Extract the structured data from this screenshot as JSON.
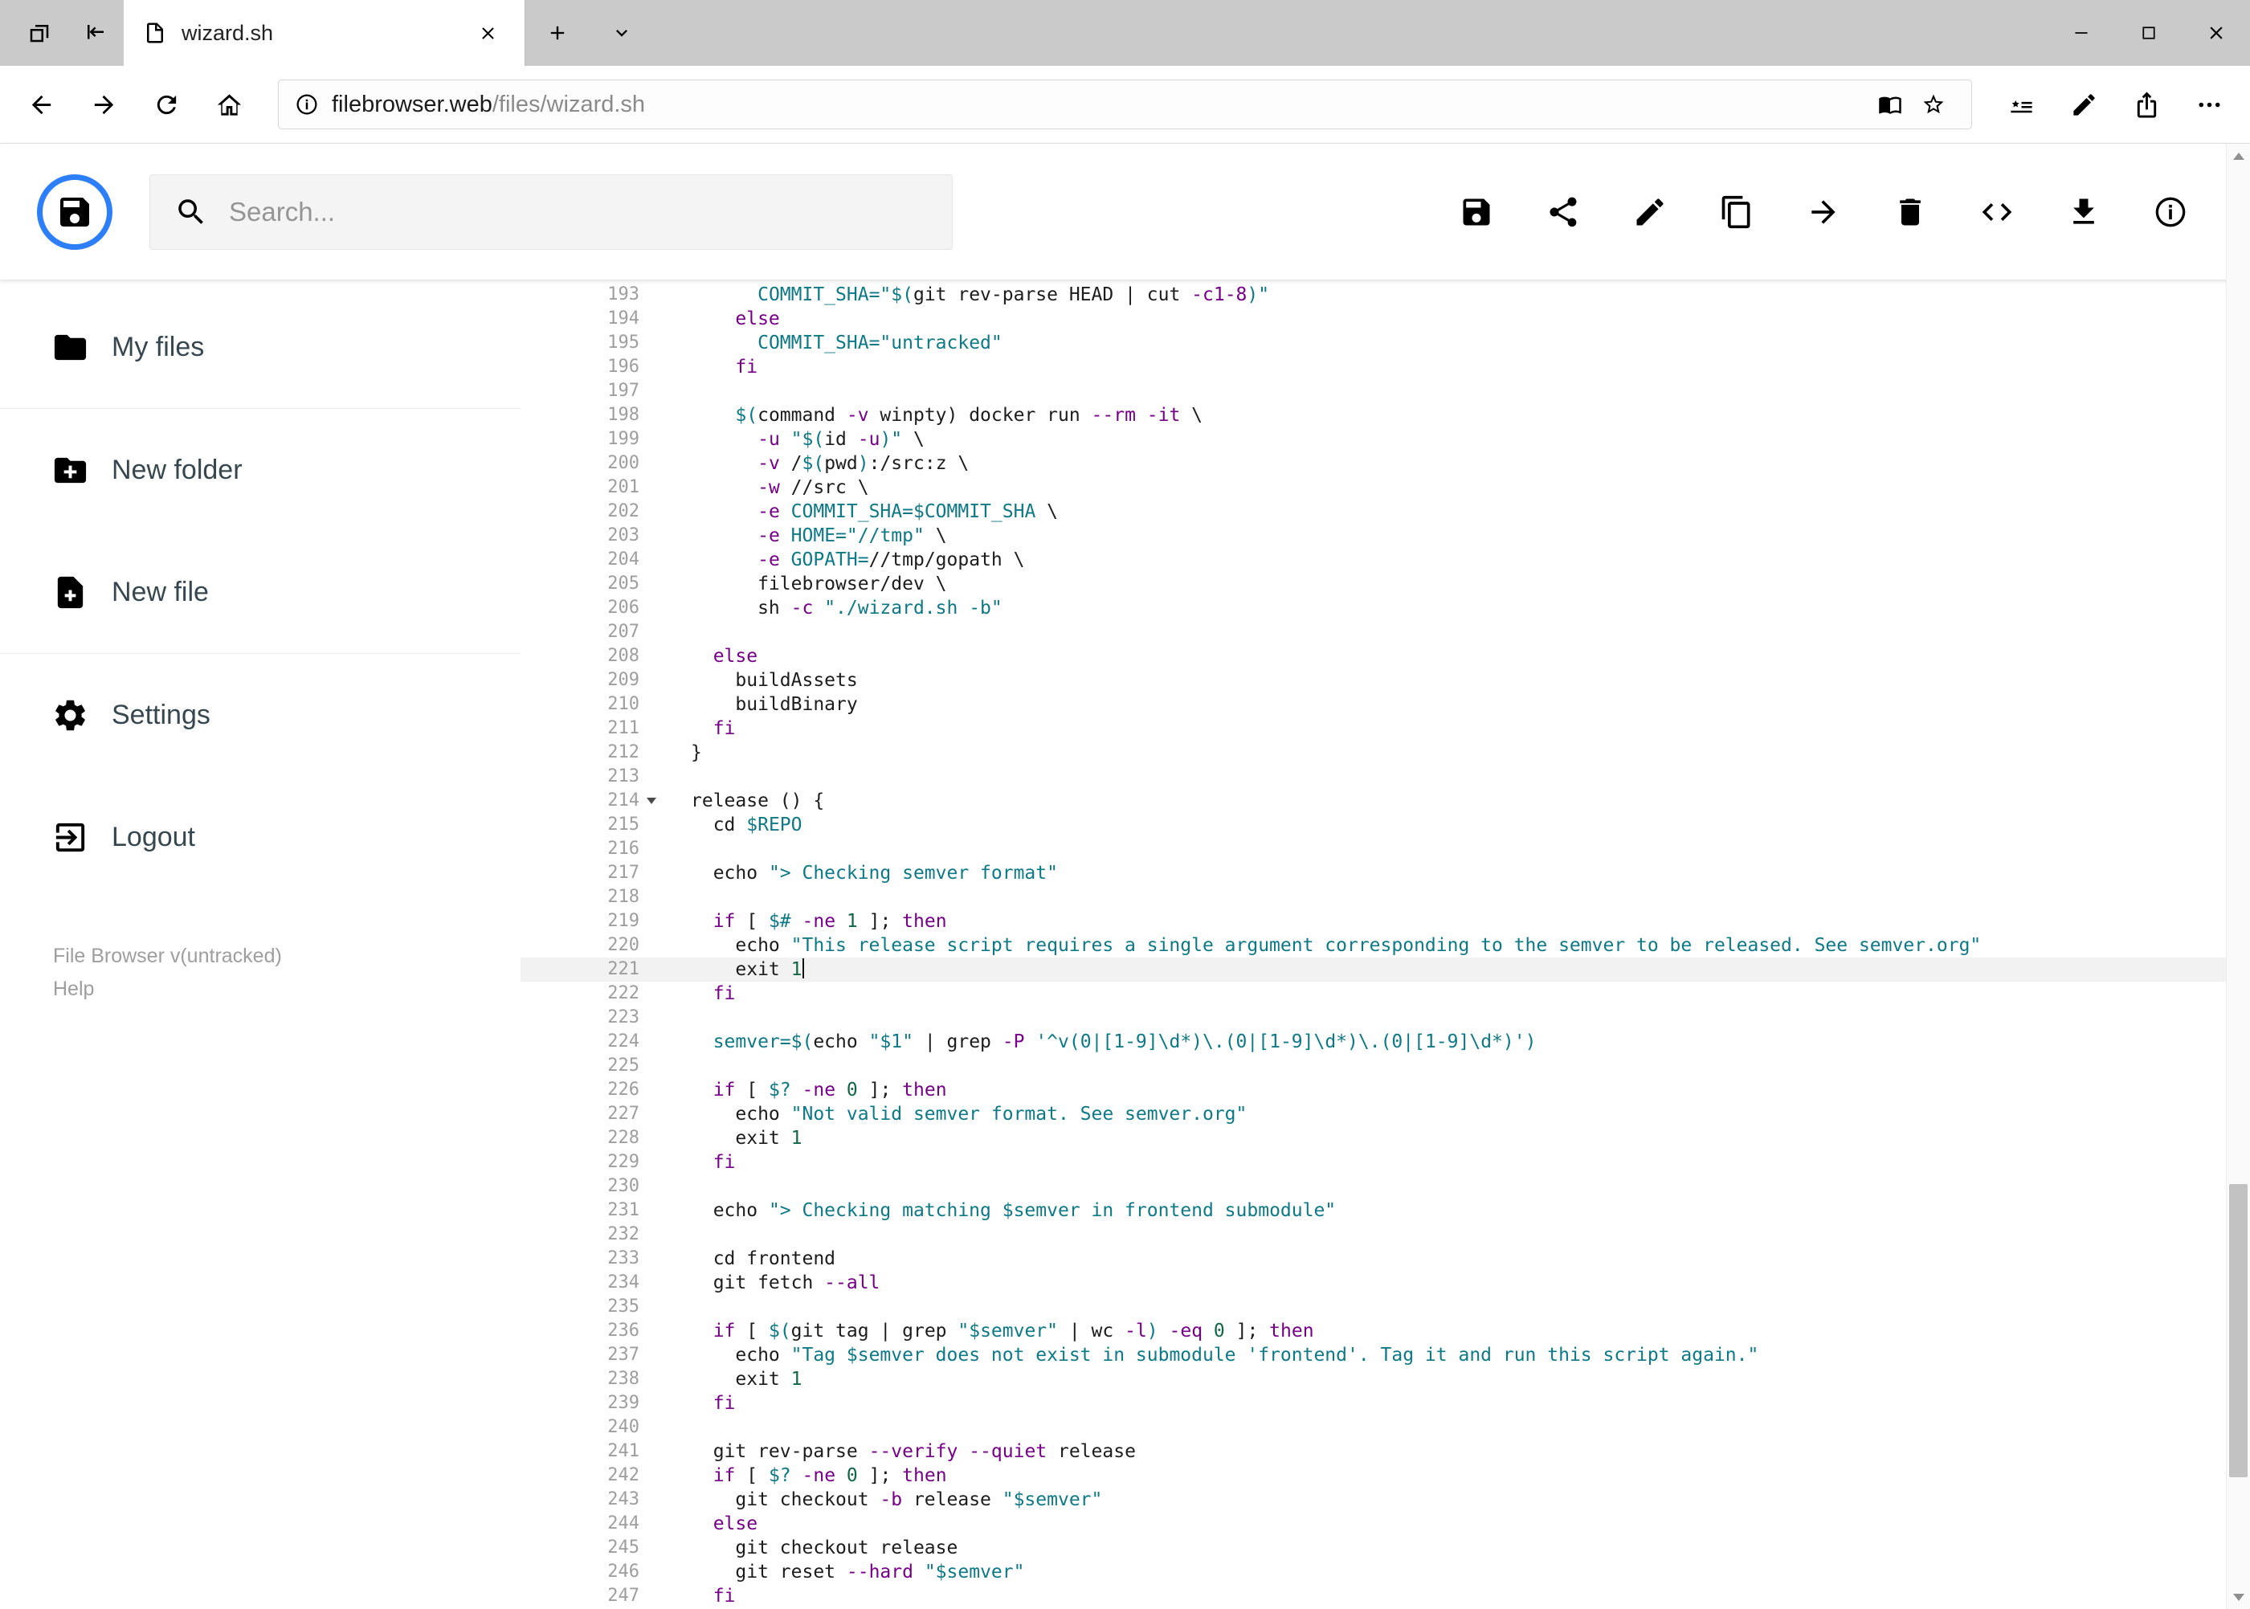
{
  "browser": {
    "tab_title": "wizard.sh",
    "url_host": "filebrowser.web",
    "url_path": "/files/wizard.sh",
    "tab_bar_icons": [
      "tab-preview-icon",
      "set-tabs-aside-icon",
      "page-file-icon",
      "tab-close-icon",
      "new-tab-icon",
      "tab-list-chevron-icon",
      "minimize-icon",
      "maximize-icon",
      "close-icon"
    ],
    "nav_icons": [
      "back-icon",
      "forward-icon",
      "refresh-icon",
      "home-icon",
      "site-info-icon",
      "reading-view-icon",
      "favorite-star-icon",
      "hub-icon",
      "web-note-icon",
      "share-icon",
      "more-options-icon"
    ]
  },
  "header": {
    "search_placeholder": "Search...",
    "logo_icon": "filebrowser-floppy-logo",
    "accent_color": "#2d7ff9",
    "action_icons": [
      "save-floppy-icon",
      "share-icon",
      "edit-pencil-icon",
      "copy-icon",
      "move-arrow-icon",
      "delete-trash-icon",
      "code-view-icon",
      "download-icon",
      "info-icon"
    ]
  },
  "sidebar": {
    "items": [
      {
        "label": "My files",
        "icon": "folder-icon"
      },
      {
        "label": "New folder",
        "icon": "new-folder-icon"
      },
      {
        "label": "New file",
        "icon": "new-file-icon"
      },
      {
        "label": "Settings",
        "icon": "settings-gear-icon"
      },
      {
        "label": "Logout",
        "icon": "logout-icon"
      }
    ],
    "footer": {
      "version": "File Browser v(untracked)",
      "help": "Help"
    }
  },
  "editor": {
    "language": "shell",
    "first_line": 193,
    "last_line": 247,
    "active_line": 221,
    "cursor_line": 221,
    "fold_marker_line": 214,
    "token_colors": {
      "plain": "#1c1c1c",
      "keyword": "#770088",
      "string": "#0d7987",
      "variable": "#0d7987",
      "number": "#116644",
      "gutter": "#9e9e9e"
    },
    "lines": [
      {
        "n": 193,
        "t": [
          [
            "      ",
            "p"
          ],
          [
            "COMMIT_SHA=",
            "v"
          ],
          [
            "\"$(",
            "s"
          ],
          [
            "git rev-parse HEAD | cut ",
            "p"
          ],
          [
            "-c1-8",
            "k"
          ],
          [
            ")\"",
            "s"
          ]
        ]
      },
      {
        "n": 194,
        "t": [
          [
            "    ",
            "p"
          ],
          [
            "else",
            "k"
          ]
        ]
      },
      {
        "n": 195,
        "t": [
          [
            "      ",
            "p"
          ],
          [
            "COMMIT_SHA=",
            "v"
          ],
          [
            "\"untracked\"",
            "s"
          ]
        ]
      },
      {
        "n": 196,
        "t": [
          [
            "    ",
            "p"
          ],
          [
            "fi",
            "k"
          ]
        ]
      },
      {
        "n": 197,
        "t": []
      },
      {
        "n": 198,
        "t": [
          [
            "    ",
            "p"
          ],
          [
            "$(",
            "v"
          ],
          [
            "command ",
            "p"
          ],
          [
            "-v",
            "k"
          ],
          [
            " winpty) docker run ",
            "p"
          ],
          [
            "--rm",
            "k"
          ],
          [
            " ",
            "p"
          ],
          [
            "-it",
            "k"
          ],
          [
            " \\",
            "p"
          ]
        ]
      },
      {
        "n": 199,
        "t": [
          [
            "      ",
            "p"
          ],
          [
            "-u",
            "k"
          ],
          [
            " ",
            "p"
          ],
          [
            "\"$(",
            "s"
          ],
          [
            "id ",
            "p"
          ],
          [
            "-u",
            "k"
          ],
          [
            ")\"",
            "s"
          ],
          [
            " \\",
            "p"
          ]
        ]
      },
      {
        "n": 200,
        "t": [
          [
            "      ",
            "p"
          ],
          [
            "-v",
            "k"
          ],
          [
            " /",
            "p"
          ],
          [
            "$(",
            "v"
          ],
          [
            "pwd",
            "p"
          ],
          [
            ")",
            "v"
          ],
          [
            ":/src:z \\",
            "p"
          ]
        ]
      },
      {
        "n": 201,
        "t": [
          [
            "      ",
            "p"
          ],
          [
            "-w",
            "k"
          ],
          [
            " //src \\",
            "p"
          ]
        ]
      },
      {
        "n": 202,
        "t": [
          [
            "      ",
            "p"
          ],
          [
            "-e",
            "k"
          ],
          [
            " ",
            "p"
          ],
          [
            "COMMIT_SHA=$COMMIT_SHA",
            "v"
          ],
          [
            " \\",
            "p"
          ]
        ]
      },
      {
        "n": 203,
        "t": [
          [
            "      ",
            "p"
          ],
          [
            "-e",
            "k"
          ],
          [
            " ",
            "p"
          ],
          [
            "HOME=",
            "v"
          ],
          [
            "\"//tmp\"",
            "s"
          ],
          [
            " \\",
            "p"
          ]
        ]
      },
      {
        "n": 204,
        "t": [
          [
            "      ",
            "p"
          ],
          [
            "-e",
            "k"
          ],
          [
            " ",
            "p"
          ],
          [
            "GOPATH=",
            "v"
          ],
          [
            "//tmp/gopath \\",
            "p"
          ]
        ]
      },
      {
        "n": 205,
        "t": [
          [
            "      filebrowser/dev \\",
            "p"
          ]
        ]
      },
      {
        "n": 206,
        "t": [
          [
            "      sh ",
            "p"
          ],
          [
            "-c",
            "k"
          ],
          [
            " ",
            "p"
          ],
          [
            "\"./wizard.sh -b\"",
            "s"
          ]
        ]
      },
      {
        "n": 207,
        "t": []
      },
      {
        "n": 208,
        "t": [
          [
            "  ",
            "p"
          ],
          [
            "else",
            "k"
          ]
        ]
      },
      {
        "n": 209,
        "t": [
          [
            "    buildAssets",
            "p"
          ]
        ]
      },
      {
        "n": 210,
        "t": [
          [
            "    buildBinary",
            "p"
          ]
        ]
      },
      {
        "n": 211,
        "t": [
          [
            "  ",
            "p"
          ],
          [
            "fi",
            "k"
          ]
        ]
      },
      {
        "n": 212,
        "t": [
          [
            "}",
            "p"
          ]
        ]
      },
      {
        "n": 213,
        "t": []
      },
      {
        "n": 214,
        "t": [
          [
            "release () {",
            "p"
          ]
        ]
      },
      {
        "n": 215,
        "t": [
          [
            "  cd ",
            "p"
          ],
          [
            "$REPO",
            "v"
          ]
        ]
      },
      {
        "n": 216,
        "t": []
      },
      {
        "n": 217,
        "t": [
          [
            "  echo ",
            "p"
          ],
          [
            "\"> Checking semver format\"",
            "s"
          ]
        ]
      },
      {
        "n": 218,
        "t": []
      },
      {
        "n": 219,
        "t": [
          [
            "  ",
            "p"
          ],
          [
            "if",
            "k"
          ],
          [
            " [ ",
            "p"
          ],
          [
            "$#",
            "v"
          ],
          [
            " ",
            "p"
          ],
          [
            "-ne",
            "k"
          ],
          [
            " ",
            "p"
          ],
          [
            "1",
            "n"
          ],
          [
            " ]; ",
            "p"
          ],
          [
            "then",
            "k"
          ]
        ]
      },
      {
        "n": 220,
        "t": [
          [
            "    echo ",
            "p"
          ],
          [
            "\"This release script requires a single argument corresponding to the semver to be released. See semver.org\"",
            "s"
          ]
        ]
      },
      {
        "n": 221,
        "t": [
          [
            "    exit ",
            "p"
          ],
          [
            "1",
            "n"
          ]
        ]
      },
      {
        "n": 222,
        "t": [
          [
            "  ",
            "p"
          ],
          [
            "fi",
            "k"
          ]
        ]
      },
      {
        "n": 223,
        "t": []
      },
      {
        "n": 224,
        "t": [
          [
            "  ",
            "p"
          ],
          [
            "semver=$(",
            "v"
          ],
          [
            "echo ",
            "p"
          ],
          [
            "\"$1\"",
            "s"
          ],
          [
            " | grep ",
            "p"
          ],
          [
            "-P",
            "k"
          ],
          [
            " ",
            "p"
          ],
          [
            "'^v(0|[1-9]\\d*)\\.(0|[1-9]\\d*)\\.(0|[1-9]\\d*)'",
            "s"
          ],
          [
            ")",
            "v"
          ]
        ]
      },
      {
        "n": 225,
        "t": []
      },
      {
        "n": 226,
        "t": [
          [
            "  ",
            "p"
          ],
          [
            "if",
            "k"
          ],
          [
            " [ ",
            "p"
          ],
          [
            "$?",
            "v"
          ],
          [
            " ",
            "p"
          ],
          [
            "-ne",
            "k"
          ],
          [
            " ",
            "p"
          ],
          [
            "0",
            "n"
          ],
          [
            " ]; ",
            "p"
          ],
          [
            "then",
            "k"
          ]
        ]
      },
      {
        "n": 227,
        "t": [
          [
            "    echo ",
            "p"
          ],
          [
            "\"Not valid semver format. See semver.org\"",
            "s"
          ]
        ]
      },
      {
        "n": 228,
        "t": [
          [
            "    exit ",
            "p"
          ],
          [
            "1",
            "n"
          ]
        ]
      },
      {
        "n": 229,
        "t": [
          [
            "  ",
            "p"
          ],
          [
            "fi",
            "k"
          ]
        ]
      },
      {
        "n": 230,
        "t": []
      },
      {
        "n": 231,
        "t": [
          [
            "  echo ",
            "p"
          ],
          [
            "\"> Checking matching ",
            "s"
          ],
          [
            "$semver",
            "v"
          ],
          [
            " in frontend submodule\"",
            "s"
          ]
        ]
      },
      {
        "n": 232,
        "t": []
      },
      {
        "n": 233,
        "t": [
          [
            "  cd frontend",
            "p"
          ]
        ]
      },
      {
        "n": 234,
        "t": [
          [
            "  git fetch ",
            "p"
          ],
          [
            "--all",
            "k"
          ]
        ]
      },
      {
        "n": 235,
        "t": []
      },
      {
        "n": 236,
        "t": [
          [
            "  ",
            "p"
          ],
          [
            "if",
            "k"
          ],
          [
            " [ ",
            "p"
          ],
          [
            "$(",
            "v"
          ],
          [
            "git tag | grep ",
            "p"
          ],
          [
            "\"$semver\"",
            "s"
          ],
          [
            " | wc ",
            "p"
          ],
          [
            "-l",
            "k"
          ],
          [
            ")",
            "v"
          ],
          [
            " ",
            "p"
          ],
          [
            "-eq",
            "k"
          ],
          [
            " ",
            "p"
          ],
          [
            "0",
            "n"
          ],
          [
            " ]; ",
            "p"
          ],
          [
            "then",
            "k"
          ]
        ]
      },
      {
        "n": 237,
        "t": [
          [
            "    echo ",
            "p"
          ],
          [
            "\"Tag ",
            "s"
          ],
          [
            "$semver",
            "v"
          ],
          [
            " does not exist in submodule 'frontend'. Tag it and run this script again.\"",
            "s"
          ]
        ]
      },
      {
        "n": 238,
        "t": [
          [
            "    exit ",
            "p"
          ],
          [
            "1",
            "n"
          ]
        ]
      },
      {
        "n": 239,
        "t": [
          [
            "  ",
            "p"
          ],
          [
            "fi",
            "k"
          ]
        ]
      },
      {
        "n": 240,
        "t": []
      },
      {
        "n": 241,
        "t": [
          [
            "  git rev-parse ",
            "p"
          ],
          [
            "--verify",
            "k"
          ],
          [
            " ",
            "p"
          ],
          [
            "--quiet",
            "k"
          ],
          [
            " release",
            "p"
          ]
        ]
      },
      {
        "n": 242,
        "t": [
          [
            "  ",
            "p"
          ],
          [
            "if",
            "k"
          ],
          [
            " [ ",
            "p"
          ],
          [
            "$?",
            "v"
          ],
          [
            " ",
            "p"
          ],
          [
            "-ne",
            "k"
          ],
          [
            " ",
            "p"
          ],
          [
            "0",
            "n"
          ],
          [
            " ]; ",
            "p"
          ],
          [
            "then",
            "k"
          ]
        ]
      },
      {
        "n": 243,
        "t": [
          [
            "    git checkout ",
            "p"
          ],
          [
            "-b",
            "k"
          ],
          [
            " release ",
            "p"
          ],
          [
            "\"$semver\"",
            "s"
          ]
        ]
      },
      {
        "n": 244,
        "t": [
          [
            "  ",
            "p"
          ],
          [
            "else",
            "k"
          ]
        ]
      },
      {
        "n": 245,
        "t": [
          [
            "    git checkout release",
            "p"
          ]
        ]
      },
      {
        "n": 246,
        "t": [
          [
            "    git reset ",
            "p"
          ],
          [
            "--hard",
            "k"
          ],
          [
            " ",
            "p"
          ],
          [
            "\"$semver\"",
            "s"
          ]
        ]
      },
      {
        "n": 247,
        "t": [
          [
            "  ",
            "p"
          ],
          [
            "fi",
            "k"
          ]
        ]
      }
    ]
  },
  "scrollbar": {
    "thumb_top_pct": 71,
    "thumb_height_pct": 20
  }
}
